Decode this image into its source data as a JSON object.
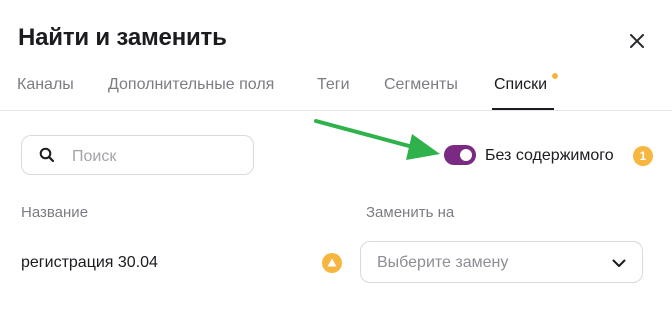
{
  "dialog": {
    "title": "Найти и заменить"
  },
  "tabs": [
    {
      "label": "Каналы"
    },
    {
      "label": "Дополнительные поля"
    },
    {
      "label": "Теги"
    },
    {
      "label": "Сегменты"
    },
    {
      "label": "Списки",
      "active": true
    }
  ],
  "search": {
    "placeholder": "Поиск",
    "value": ""
  },
  "filter": {
    "label": "Без содержимого",
    "enabled": true,
    "count": "1"
  },
  "columns": {
    "name": "Название",
    "replace": "Заменить на"
  },
  "rows": [
    {
      "name": "регистрация 30.04",
      "replace_placeholder": "Выберите замену"
    }
  ],
  "colors": {
    "toggle_on": "#7a2a82",
    "badge": "#f6b640",
    "arrow": "#2fb24b"
  },
  "icons": {
    "close": "close-icon",
    "search": "search-icon",
    "warning": "warning-icon",
    "chevron": "chevron-down-icon",
    "arrow": "arrow-icon"
  }
}
